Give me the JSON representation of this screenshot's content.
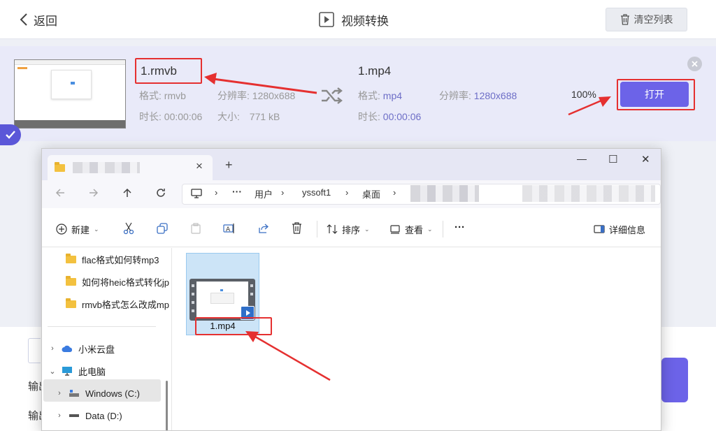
{
  "app": {
    "back_label": "返回",
    "title": "视频转换",
    "clear_label": "清空列表"
  },
  "task": {
    "source": {
      "name": "1.rmvb",
      "format_label": "格式:",
      "format": "rmvb",
      "resolution_label": "分辨率:",
      "resolution": "1280x688",
      "duration_label": "时长:",
      "duration": "00:00:06",
      "size_label": "大小:",
      "size": "771 kB"
    },
    "target": {
      "name": "1.mp4",
      "format_label": "格式:",
      "format": "mp4",
      "resolution_label": "分辨率:",
      "resolution": "1280x688",
      "duration_label": "时长:",
      "duration": "00:00:06"
    },
    "progress_text": "100%",
    "progress": 1.0,
    "open_label": "打开"
  },
  "bottom": {
    "label1": "输出",
    "label2": "输出"
  },
  "explorer": {
    "window_controls": {
      "minimize": "—",
      "maximize": "☐",
      "close": "✕"
    },
    "tab_close": "×",
    "new_tab": "+",
    "breadcrumb": [
      "用户",
      "yssoft1",
      "桌面"
    ],
    "more_crumbs": "···",
    "commands": {
      "new": "新建",
      "sort": "排序",
      "view": "查看",
      "more": "···",
      "details": "详细信息"
    },
    "nav_folders": [
      "flac格式如何转mp3",
      "如何将heic格式转化jp",
      "rmvb格式怎么改成mp"
    ],
    "nav_tree": [
      {
        "label": "小米云盘",
        "expanded": false
      },
      {
        "label": "此电脑",
        "expanded": true
      },
      {
        "label": "Windows (C:)",
        "expanded": false,
        "selected": true
      },
      {
        "label": "Data (D:)",
        "expanded": false
      }
    ],
    "file": {
      "name": "1.mp4"
    }
  },
  "colors": {
    "accent": "#6c63e8",
    "annotation_red": "#e53030",
    "card_bg": "#e9eaf9",
    "selection_blue": "#cce4f7"
  }
}
